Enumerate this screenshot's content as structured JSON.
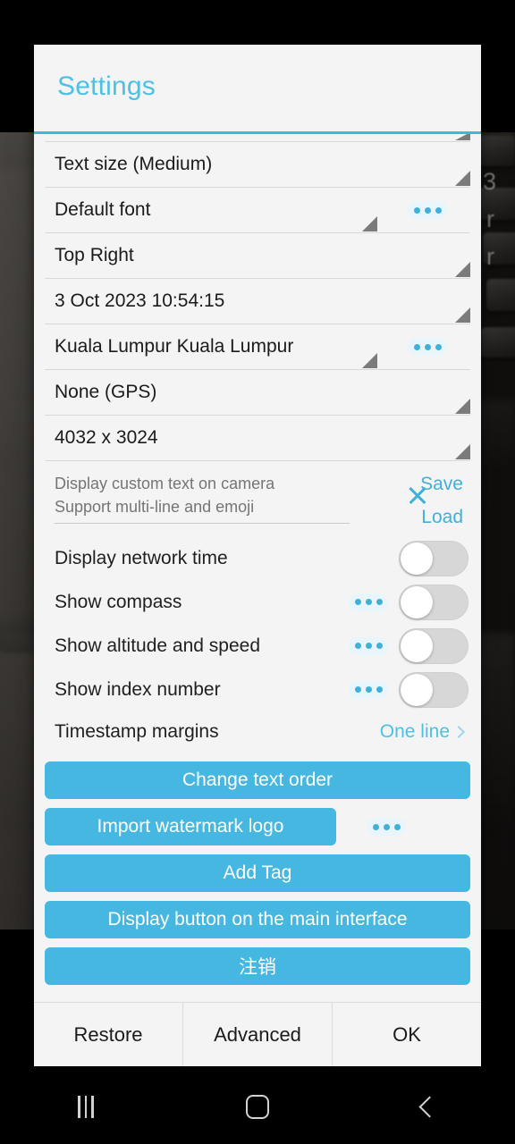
{
  "dialog": {
    "title": "Settings"
  },
  "spinners": [
    {
      "name": "text-size",
      "value": "Text size (Medium)",
      "kebab": false
    },
    {
      "name": "font",
      "value": "Default font",
      "kebab": true
    },
    {
      "name": "position",
      "value": "Top Right",
      "kebab": false
    },
    {
      "name": "datetime",
      "value": "3 Oct 2023 10:54:15",
      "kebab": false
    },
    {
      "name": "location",
      "value": "Kuala Lumpur Kuala Lumpur",
      "kebab": true
    },
    {
      "name": "coordinates",
      "value": "None (GPS)",
      "kebab": false
    },
    {
      "name": "resolution",
      "value": "4032 x 3024",
      "kebab": false
    }
  ],
  "custom_text": {
    "placeholder": "Display custom text on camera\nSupport multi-line and emoji",
    "value": "",
    "clear_icon": "close-icon",
    "save_label": "Save",
    "load_label": "Load"
  },
  "toggles": [
    {
      "name": "display-network-time",
      "label": "Display network time",
      "checked": false,
      "kebab": false
    },
    {
      "name": "show-compass",
      "label": "Show compass",
      "checked": false,
      "kebab": true
    },
    {
      "name": "show-altitude-speed",
      "label": "Show altitude and speed",
      "checked": false,
      "kebab": true
    },
    {
      "name": "show-index-number",
      "label": "Show index number",
      "checked": false,
      "kebab": true
    }
  ],
  "timestamp_margins": {
    "label": "Timestamp margins",
    "value": "One line",
    "chevron": "chevron-right-icon"
  },
  "action_buttons": [
    {
      "name": "change-text-order",
      "label": "Change text order",
      "full": true,
      "kebab": false
    },
    {
      "name": "import-watermark-logo",
      "label": "Import watermark logo",
      "full": false,
      "kebab": true
    },
    {
      "name": "add-tag",
      "label": "Add Tag",
      "full": true,
      "kebab": false
    },
    {
      "name": "display-button-main-interface",
      "label": "Display button on the main interface",
      "full": true,
      "kebab": false
    },
    {
      "name": "logout",
      "label": "注销",
      "full": true,
      "kebab": false
    }
  ],
  "footer": {
    "restore_label": "Restore",
    "advanced_label": "Advanced",
    "ok_label": "OK"
  },
  "navbar": {
    "recents": "recents-icon",
    "home": "home-icon",
    "back": "back-icon"
  },
  "background": {
    "watermark_fragments": [
      "3",
      "r",
      "r"
    ]
  },
  "colors": {
    "accent": "#45b7e0",
    "title": "#4ec1e3",
    "dialog_bg": "#f4f4f4",
    "switch_track": "#d7d7d7"
  }
}
